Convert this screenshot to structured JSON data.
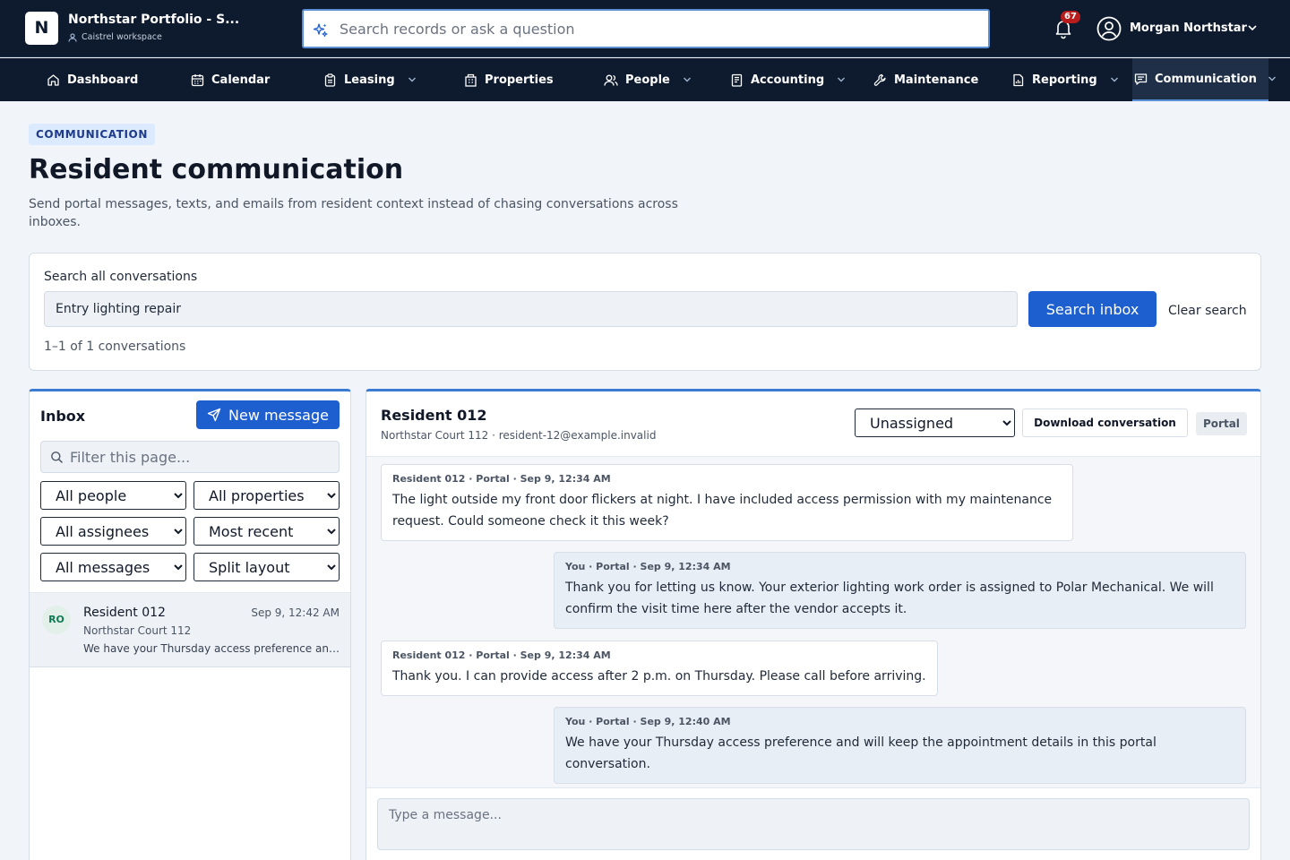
{
  "header": {
    "logo_letter": "N",
    "title": "Northstar Portfolio - S...",
    "workspace": "Caistrel workspace",
    "search_placeholder": "Search records or ask a question",
    "notification_count": "67",
    "user_name": "Morgan Northstar"
  },
  "nav": {
    "items": [
      {
        "label": "Dashboard",
        "icon": "home-icon"
      },
      {
        "label": "Calendar",
        "icon": "calendar-icon"
      },
      {
        "label": "Leasing",
        "icon": "clipboard-icon",
        "dropdown": true
      },
      {
        "label": "Properties",
        "icon": "building-icon"
      },
      {
        "label": "People",
        "icon": "people-icon",
        "dropdown": true
      },
      {
        "label": "Accounting",
        "icon": "ledger-icon",
        "dropdown": true
      },
      {
        "label": "Maintenance",
        "icon": "wrench-icon"
      },
      {
        "label": "Reporting",
        "icon": "report-icon",
        "dropdown": true
      },
      {
        "label": "Communication",
        "icon": "chat-icon",
        "dropdown": true,
        "active": true
      }
    ]
  },
  "page": {
    "tag": "COMMUNICATION",
    "title": "Resident communication",
    "description": "Send portal messages, texts, and emails from resident context instead of chasing conversations across inboxes."
  },
  "search_card": {
    "label": "Search all conversations",
    "value": "Entry lighting repair",
    "search_button": "Search inbox",
    "clear_link": "Clear search",
    "result_count": "1–1 of 1 conversations"
  },
  "inbox": {
    "title": "Inbox",
    "new_message": "New message",
    "filter_placeholder": "Filter this page...",
    "filters": {
      "people": "All people",
      "properties": "All properties",
      "assignees": "All assignees",
      "sort": "Most recent",
      "messages": "All messages",
      "layout": "Split layout"
    },
    "conversations": [
      {
        "initials": "RO",
        "name": "Resident 012",
        "time": "Sep 9, 12:42 AM",
        "property": "Northstar Court 112",
        "preview": "We have your Thursday access preference and will keep the appointment details in this portal conversation."
      }
    ]
  },
  "thread": {
    "name": "Resident 012",
    "subtitle": "Northstar Court 112 · resident-12@example.invalid",
    "assignee": "Unassigned",
    "download": "Download conversation",
    "channel": "Portal",
    "messages": [
      {
        "direction": "in",
        "meta": "Resident 012 · Portal · Sep 9, 12:34 AM",
        "body": "The light outside my front door flickers at night. I have included access permission with my maintenance request. Could someone check it this week?"
      },
      {
        "direction": "out",
        "meta": "You · Portal · Sep 9, 12:34 AM",
        "body": "Thank you for letting us know. Your exterior lighting work order is assigned to Polar Mechanical. We will confirm the visit time here after the vendor accepts it."
      },
      {
        "direction": "in",
        "meta": "Resident 012 · Portal · Sep 9, 12:34 AM",
        "body": "Thank you. I can provide access after 2 p.m. on Thursday. Please call before arriving."
      },
      {
        "direction": "out",
        "meta": "You · Portal · Sep 9, 12:40 AM",
        "body": "We have your Thursday access preference and will keep the appointment details in this portal conversation."
      }
    ],
    "compose_placeholder": "Type a message..."
  },
  "colors": {
    "topbar": "#0e1b2e",
    "accent": "#1e5fd0",
    "badge": "#b91c1c"
  }
}
